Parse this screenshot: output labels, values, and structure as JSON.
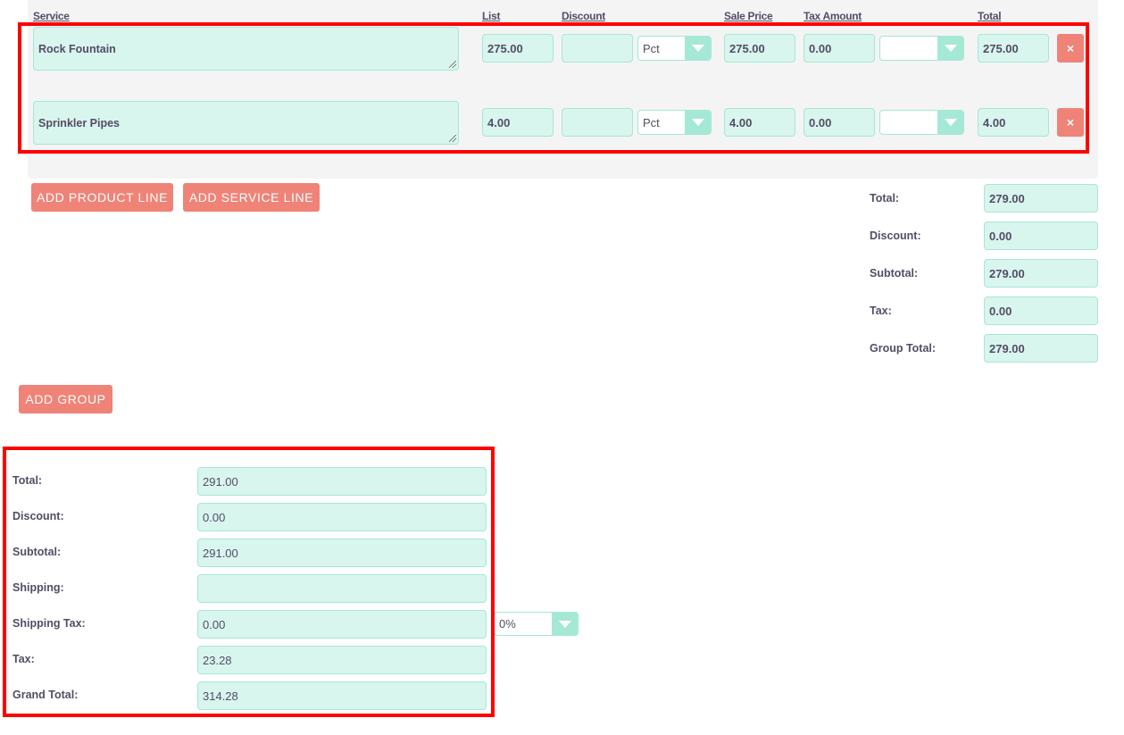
{
  "line_items": {
    "columns": {
      "service": "Service",
      "list": "List",
      "discount": "Discount",
      "sale_price": "Sale Price",
      "tax_amount": "Tax Amount",
      "total": "Total"
    },
    "rows": [
      {
        "service": "Rock Fountain",
        "list": "275.00",
        "discount": "",
        "discount_type": "Pct",
        "sale_price": "275.00",
        "tax_amount": "0.00",
        "tax_rate": "",
        "total": "275.00",
        "delete_label": "×"
      },
      {
        "service": "Sprinkler Pipes",
        "list": "4.00",
        "discount": "",
        "discount_type": "Pct",
        "sale_price": "4.00",
        "tax_amount": "0.00",
        "tax_rate": "",
        "total": "4.00",
        "delete_label": "×"
      }
    ]
  },
  "buttons": {
    "add_product_line": "ADD PRODUCT LINE",
    "add_service_line": "ADD SERVICE LINE",
    "add_group": "ADD GROUP"
  },
  "group_totals": [
    {
      "label": "Total:",
      "value": "279.00"
    },
    {
      "label": "Discount:",
      "value": "0.00"
    },
    {
      "label": "Subtotal:",
      "value": "279.00"
    },
    {
      "label": "Tax:",
      "value": "0.00"
    },
    {
      "label": "Group Total:",
      "value": "279.00"
    }
  ],
  "grand_totals": {
    "total": {
      "label": "Total:",
      "value": "291.00"
    },
    "discount": {
      "label": "Discount:",
      "value": "0.00"
    },
    "subtotal": {
      "label": "Subtotal:",
      "value": "291.00"
    },
    "shipping": {
      "label": "Shipping:",
      "value": ""
    },
    "shipping_tax": {
      "label": "Shipping Tax:",
      "value": "0.00",
      "rate": "0%"
    },
    "tax": {
      "label": "Tax:",
      "value": "23.28"
    },
    "grand_total": {
      "label": "Grand Total:",
      "value": "314.28"
    }
  },
  "colors": {
    "field_bg": "#d8f5ee",
    "field_border": "#a5e8d6",
    "button": "#f08377",
    "highlight": "#ff0000",
    "text": "#534d64"
  }
}
